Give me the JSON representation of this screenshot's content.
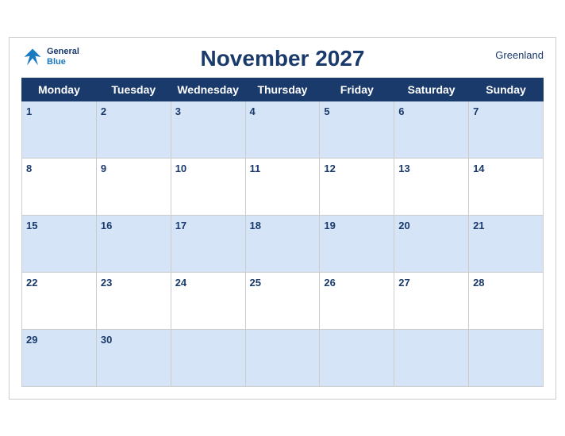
{
  "header": {
    "title": "November 2027",
    "region": "Greenland",
    "logo_general": "General",
    "logo_blue": "Blue"
  },
  "days_of_week": [
    "Monday",
    "Tuesday",
    "Wednesday",
    "Thursday",
    "Friday",
    "Saturday",
    "Sunday"
  ],
  "weeks": [
    [
      1,
      2,
      3,
      4,
      5,
      6,
      7
    ],
    [
      8,
      9,
      10,
      11,
      12,
      13,
      14
    ],
    [
      15,
      16,
      17,
      18,
      19,
      20,
      21
    ],
    [
      22,
      23,
      24,
      25,
      26,
      27,
      28
    ],
    [
      29,
      30,
      null,
      null,
      null,
      null,
      null
    ]
  ]
}
